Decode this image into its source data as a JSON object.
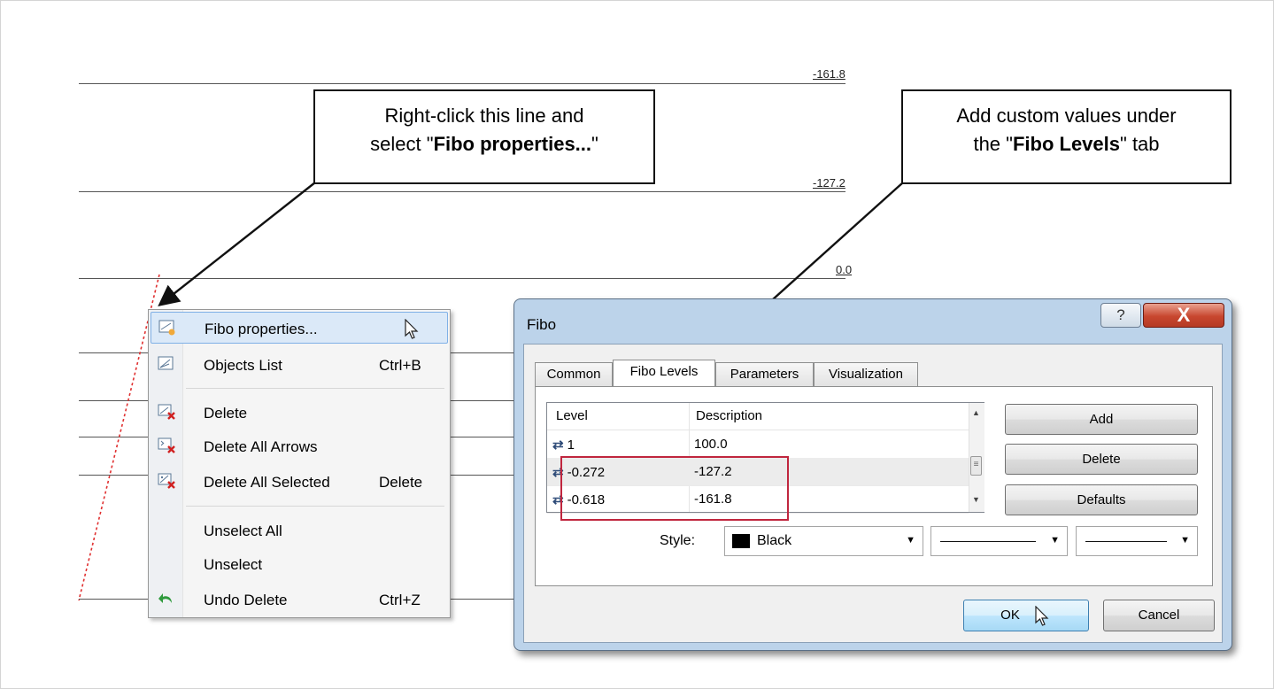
{
  "chart": {
    "levels": [
      {
        "label": "-161.8"
      },
      {
        "label": "-127.2"
      },
      {
        "label": "0.0"
      }
    ]
  },
  "callouts": {
    "left": {
      "line1": "Right-click this line and",
      "line2_pre": "select \"",
      "line2_bold": "Fibo properties...",
      "line2_post": "\""
    },
    "right": {
      "line1": "Add custom values under",
      "line2_pre": "the \"",
      "line2_bold": "Fibo Levels",
      "line2_post": "\" tab"
    }
  },
  "context_menu": {
    "items": [
      {
        "label": "Fibo properties...",
        "shortcut": "",
        "icon": "fibo-properties-icon"
      },
      {
        "label": "Objects List",
        "shortcut": "Ctrl+B",
        "icon": "objects-list-icon"
      },
      {
        "label": "Delete",
        "shortcut": "",
        "icon": "delete-icon"
      },
      {
        "label": "Delete All Arrows",
        "shortcut": "",
        "icon": "delete-arrows-icon"
      },
      {
        "label": "Delete All Selected",
        "shortcut": "Delete",
        "icon": "delete-selected-icon"
      },
      {
        "label": "Unselect All",
        "shortcut": ""
      },
      {
        "label": "Unselect",
        "shortcut": ""
      },
      {
        "label": "Undo Delete",
        "shortcut": "Ctrl+Z",
        "icon": "undo-icon"
      }
    ]
  },
  "dialog": {
    "title": "Fibo",
    "help_label": "?",
    "close_label": "X",
    "tabs": [
      "Common",
      "Fibo Levels",
      "Parameters",
      "Visualization"
    ],
    "active_tab": "Fibo Levels",
    "grid": {
      "headers": [
        "Level",
        "Description"
      ],
      "rows": [
        {
          "level": "1",
          "description": "100.0"
        },
        {
          "level": "-0.272",
          "description": "-127.2"
        },
        {
          "level": "-0.618",
          "description": "-161.8"
        }
      ],
      "scroll_thumb": "≡"
    },
    "buttons": {
      "add": "Add",
      "delete": "Delete",
      "defaults": "Defaults",
      "ok": "OK",
      "cancel": "Cancel"
    },
    "style": {
      "label": "Style:",
      "color_name": "Black",
      "color": "#000000"
    }
  },
  "colors": {
    "highlight_box": "#c0263e",
    "fibo_trend_line": "#e03030",
    "close_button": "#c8472f"
  }
}
